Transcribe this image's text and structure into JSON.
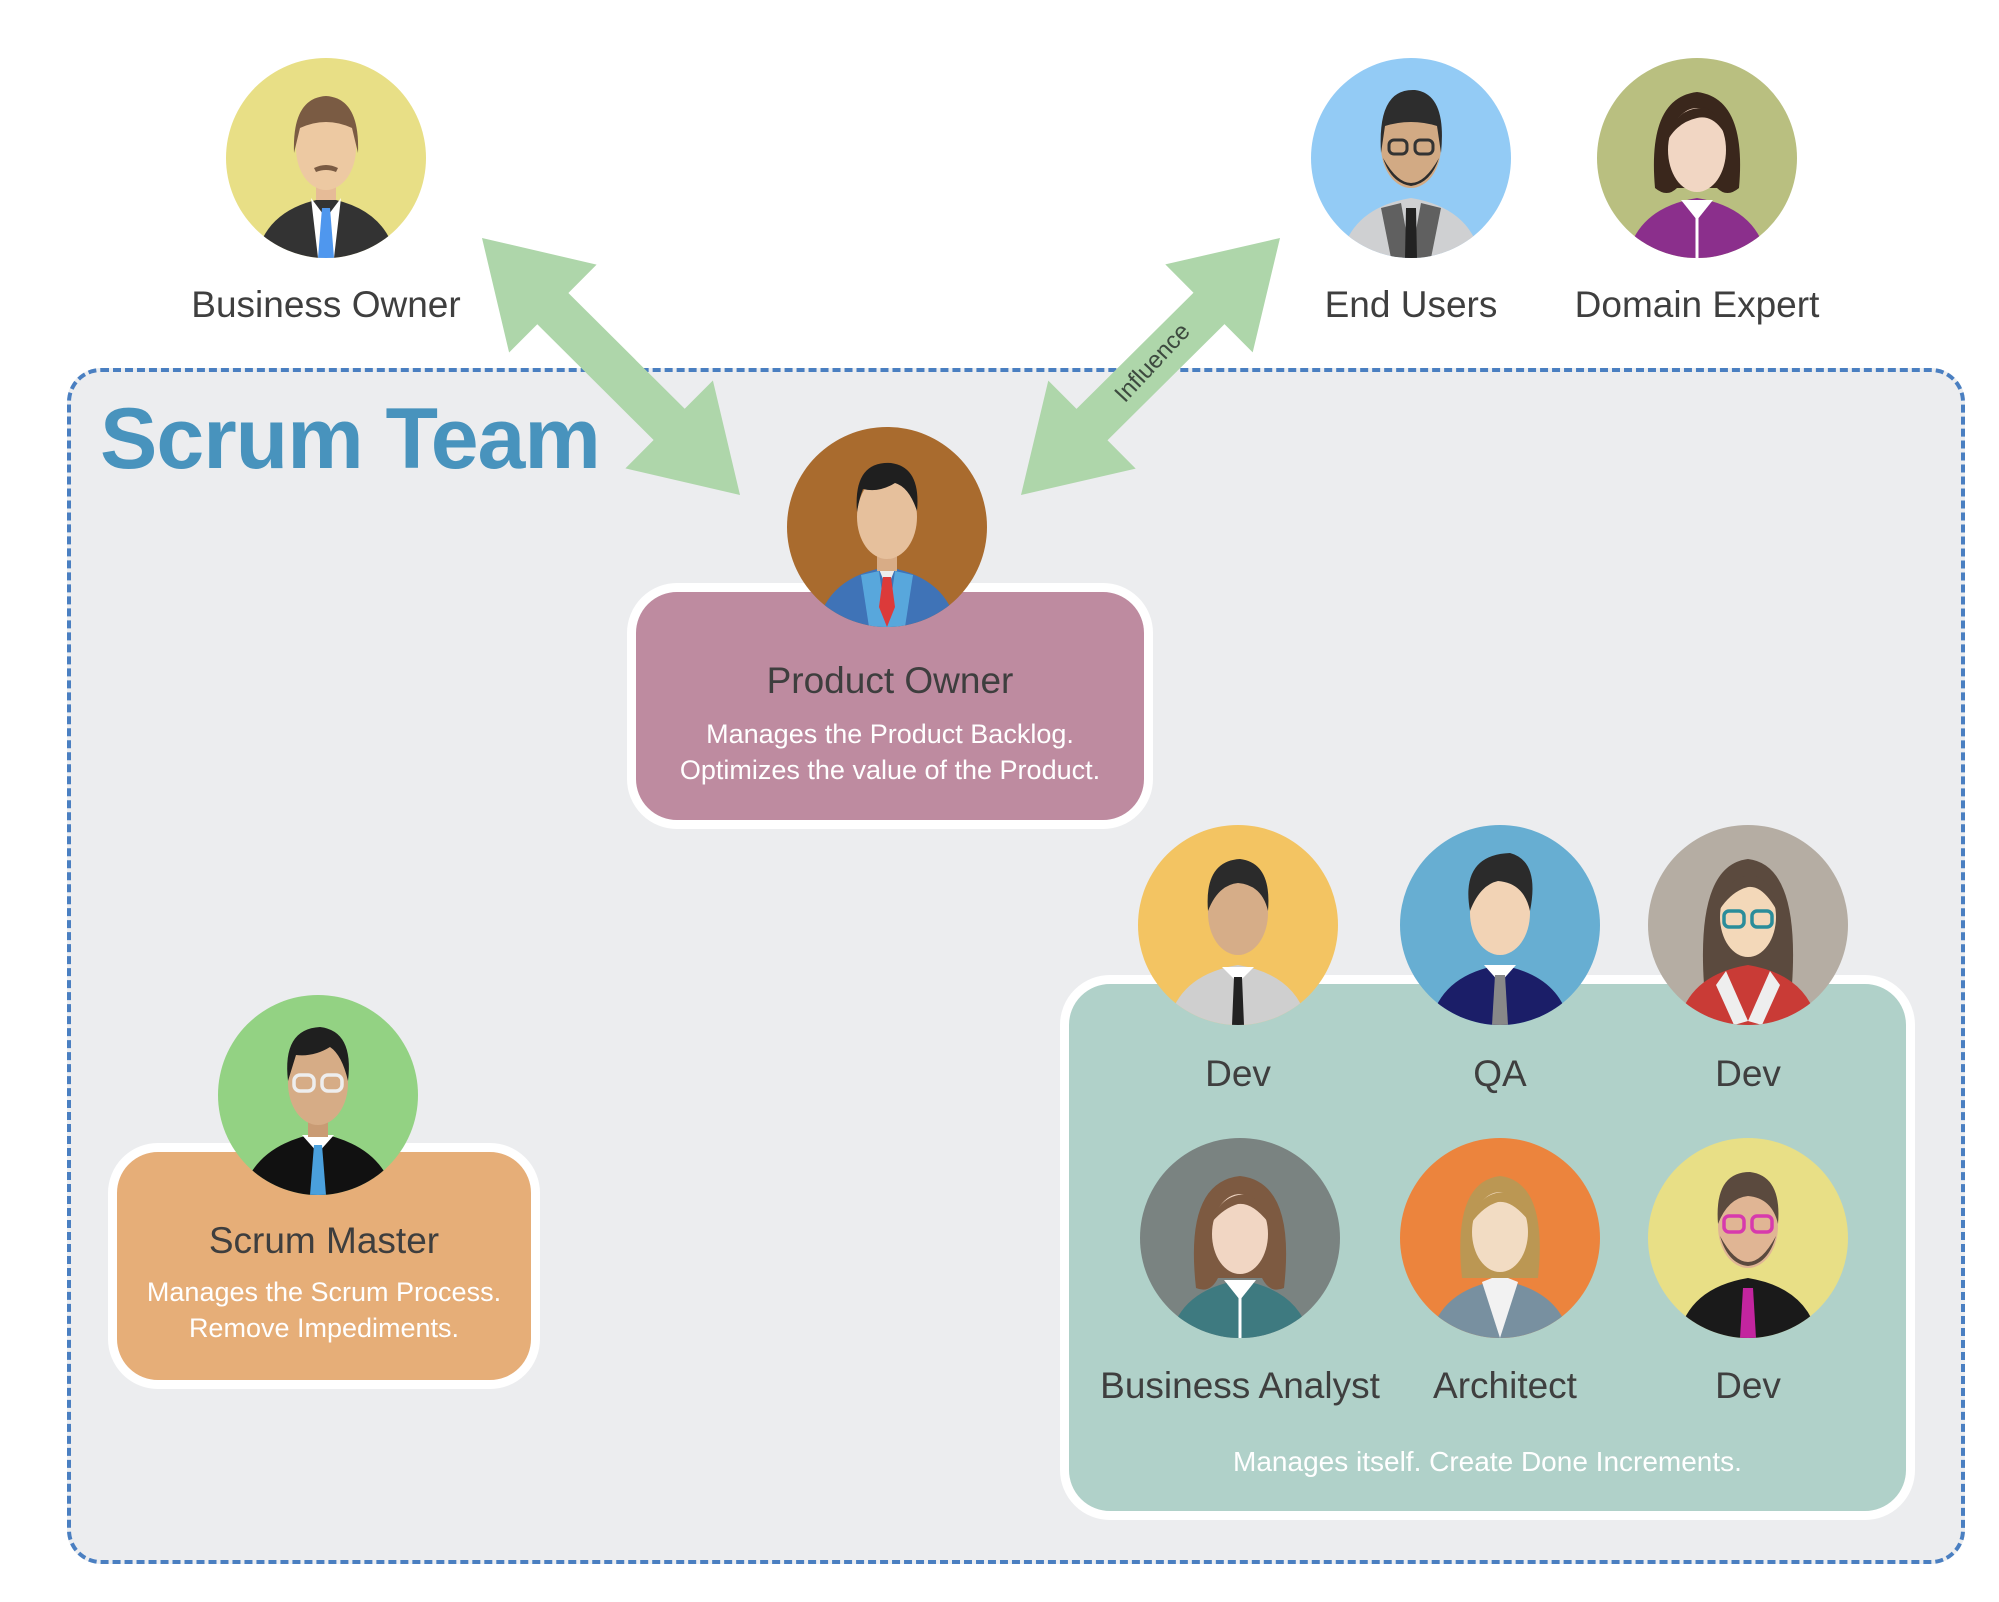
{
  "stakeholders": [
    {
      "name": "Business Owner",
      "bg": "#e8df86",
      "icon": "business-owner-avatar"
    },
    {
      "name": "End Users",
      "bg": "#93cbf5",
      "icon": "end-users-avatar"
    },
    {
      "name": "Domain Expert",
      "bg": "#b9bf80",
      "icon": "domain-expert-avatar"
    }
  ],
  "team": {
    "title": "Scrum Team",
    "frame_border_color": "#4a7fc1",
    "title_color": "#4893bd"
  },
  "arrows": {
    "color": "#aed6aa",
    "influence_label": "Influence"
  },
  "product_owner": {
    "title": "Product Owner",
    "desc_lines": [
      "Manages the Product Backlog.",
      "Optimizes the value of the Product."
    ],
    "box_color": "#be8ba0",
    "avatar_bg": "#a96b2e"
  },
  "scrum_master": {
    "title": "Scrum Master",
    "desc_lines": [
      "Manages the Scrum Process.",
      "Remove Impediments."
    ],
    "box_color": "#e6ae78",
    "avatar_bg": "#93d283"
  },
  "dev_team": {
    "box_color": "#b0d1c9",
    "members": [
      {
        "name": "Dev",
        "bg": "#f3c462"
      },
      {
        "name": "QA",
        "bg": "#67aed2"
      },
      {
        "name": "Dev",
        "bg": "#b5ada3"
      },
      {
        "name": "Business Analyst",
        "bg": "#7a8381"
      },
      {
        "name": "Architect",
        "bg": "#ec843d"
      },
      {
        "name": "Dev",
        "bg": "#e8df86"
      }
    ],
    "footer": "Manages itself.  Create Done Increments."
  }
}
